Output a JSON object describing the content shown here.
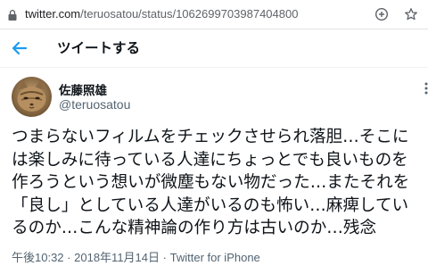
{
  "browser": {
    "url_domain": "twitter.com",
    "url_path": "/teruosatou/status/1062699703987404800",
    "icons": [
      "lock-icon",
      "add-circle-icon",
      "star-icon"
    ]
  },
  "header": {
    "back_icon": "arrow-left-icon",
    "title": "ツイートする"
  },
  "author": {
    "name": "佐藤照雄",
    "handle": "@teruosatou",
    "avatar": "cat-avatar"
  },
  "tweet": {
    "lines": [
      "つまらないフィルムをチェックさせられ落胆…そこに",
      "は楽しみに待っている人達にちょっとでも良いものを",
      "作ろうという想いが微塵もない物だった…またそれを",
      "「良し」としている人達がいるのも怖い…麻痺してい",
      "るのか…こんな精神論の作り方は古いのか…残念"
    ]
  },
  "meta": {
    "time": "午後10:32",
    "separator": "·",
    "date": "2018年11月14日",
    "source": "Twitter for iPhone"
  },
  "colors": {
    "accent": "#1d9bf0",
    "text": "#0f1419",
    "secondary": "#536471"
  }
}
